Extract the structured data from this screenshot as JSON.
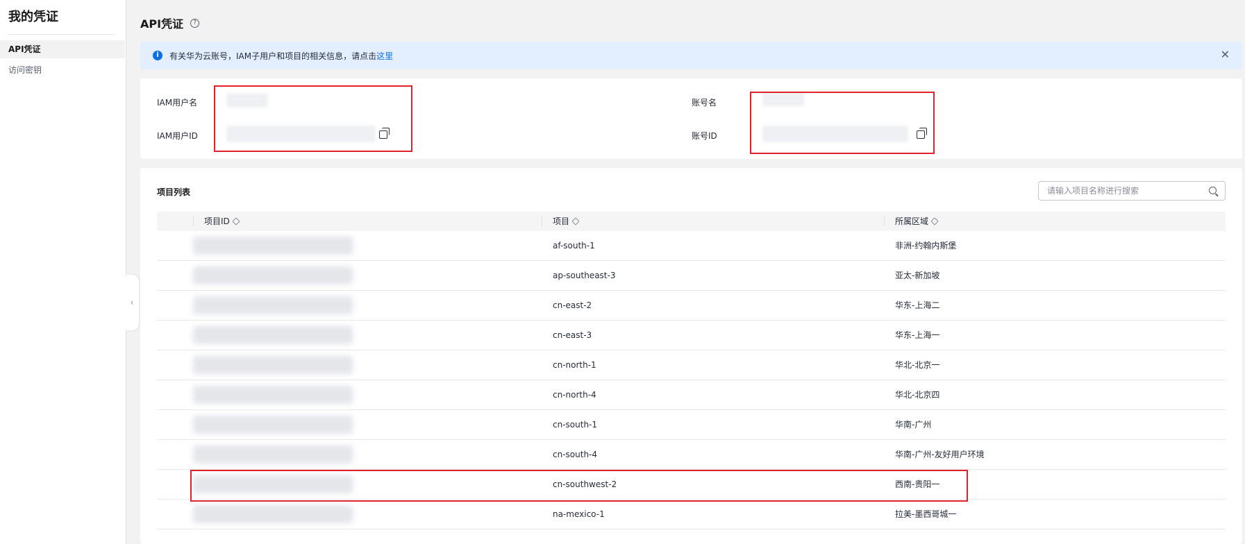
{
  "sidebar": {
    "title": "我的凭证",
    "items": [
      {
        "label": "API凭证",
        "active": true
      },
      {
        "label": "访问密钥",
        "active": false
      }
    ]
  },
  "header": {
    "title": "API凭证"
  },
  "alert": {
    "text": "有关华为云账号，IAM子用户和项目的相关信息，请点击",
    "link": "这里"
  },
  "info": {
    "iam_user_name_label": "IAM用户名",
    "iam_user_id_label": "IAM用户ID",
    "account_name_label": "账号名",
    "account_id_label": "账号ID"
  },
  "projects": {
    "title": "项目列表",
    "search_placeholder": "请输入项目名称进行搜索",
    "columns": [
      "项目ID",
      "项目",
      "所属区域"
    ],
    "rows": [
      {
        "project": "af-south-1",
        "region": "非洲-约翰内斯堡"
      },
      {
        "project": "ap-southeast-3",
        "region": "亚太-新加坡"
      },
      {
        "project": "cn-east-2",
        "region": "华东-上海二"
      },
      {
        "project": "cn-east-3",
        "region": "华东-上海一"
      },
      {
        "project": "cn-north-1",
        "region": "华北-北京一"
      },
      {
        "project": "cn-north-4",
        "region": "华北-北京四"
      },
      {
        "project": "cn-south-1",
        "region": "华南-广州"
      },
      {
        "project": "cn-south-4",
        "region": "华南-广州-友好用户环境"
      },
      {
        "project": "cn-southwest-2",
        "region": "西南-贵阳一"
      },
      {
        "project": "na-mexico-1",
        "region": "拉美-墨西哥城一"
      }
    ]
  },
  "colors": {
    "accent": "#0d6fe5",
    "highlight_border": "#e0202a",
    "alert_bg": "#e3efff"
  }
}
